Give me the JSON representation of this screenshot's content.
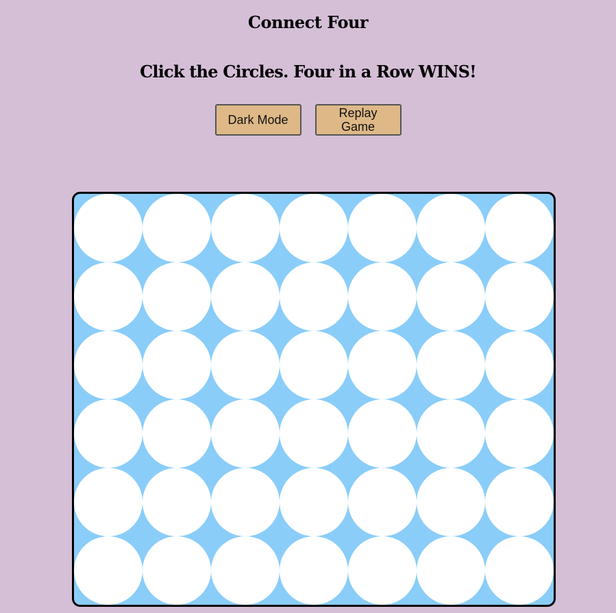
{
  "header": {
    "title": "Connect Four",
    "subtitle": "Click the Circles. Four in a Row WINS!"
  },
  "controls": {
    "dark_mode_label": "Dark Mode",
    "replay_label": "Replay Game"
  },
  "board": {
    "rows": 6,
    "columns": 7,
    "cells": [
      [
        "empty",
        "empty",
        "empty",
        "empty",
        "empty",
        "empty",
        "empty"
      ],
      [
        "empty",
        "empty",
        "empty",
        "empty",
        "empty",
        "empty",
        "empty"
      ],
      [
        "empty",
        "empty",
        "empty",
        "empty",
        "empty",
        "empty",
        "empty"
      ],
      [
        "empty",
        "empty",
        "empty",
        "empty",
        "empty",
        "empty",
        "empty"
      ],
      [
        "empty",
        "empty",
        "empty",
        "empty",
        "empty",
        "empty",
        "empty"
      ],
      [
        "empty",
        "empty",
        "empty",
        "empty",
        "empty",
        "empty",
        "empty"
      ]
    ]
  },
  "colors": {
    "background": "#d5bfd7",
    "board": "#8acdf9",
    "empty_cell": "#ffffff",
    "button": "#deb887"
  }
}
